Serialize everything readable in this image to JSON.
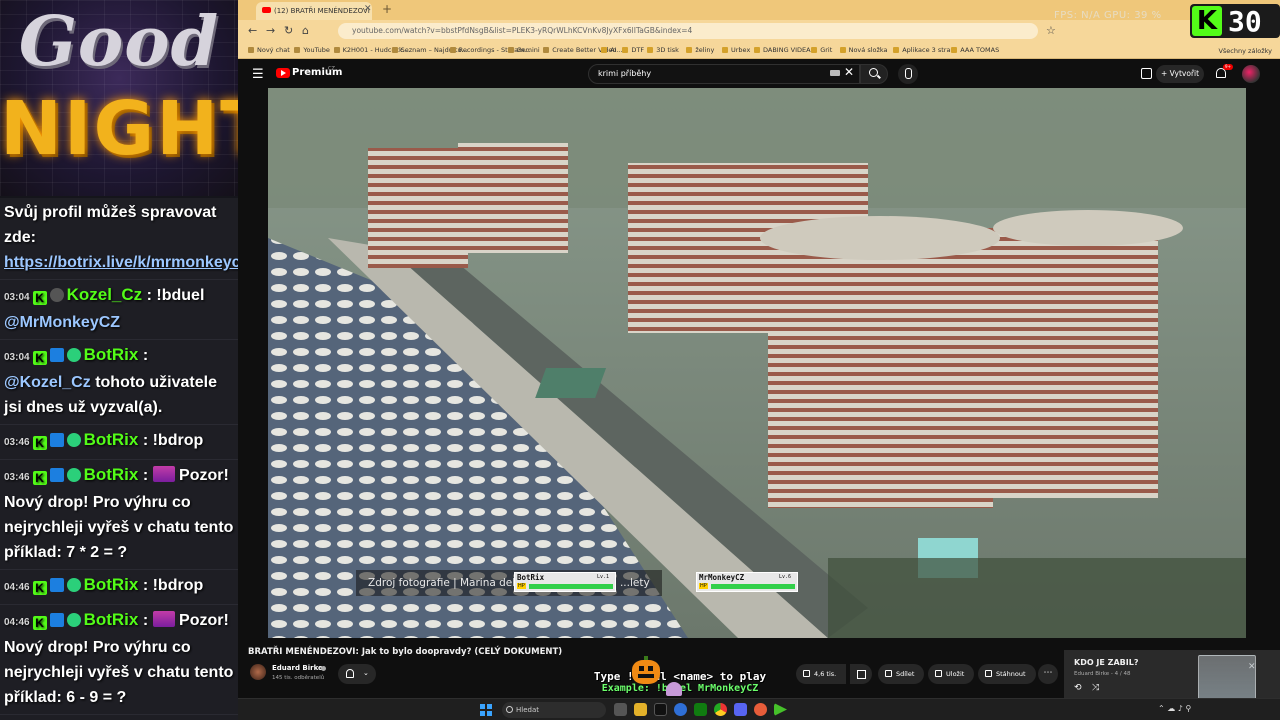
{
  "overlay": {
    "title_line1": "Good",
    "title_line2": "NIGHT",
    "counter": {
      "badge": "K",
      "value": "30"
    }
  },
  "chat": [
    {
      "id": "m1",
      "text_parts": [
        "Svůj profil můžeš spravovat zde: "
      ],
      "link": "https://botrix.live/k/mrmonkeycz/battle"
    },
    {
      "id": "m2",
      "time": "03:04",
      "user": "Kozel_Cz",
      "text": "!bduel",
      "mention": "@MrMonkeyCZ"
    },
    {
      "id": "m3",
      "time": "03:04",
      "user": "BotRix",
      "mention": "@Kozel_Cz",
      "text": "tohoto uživatele jsi dnes už vyzval(a)."
    },
    {
      "id": "m4",
      "time": "03:46",
      "user": "BotRix",
      "text": "!bdrop"
    },
    {
      "id": "m5",
      "time": "03:46",
      "user": "BotRix",
      "text": "Pozor! Nový drop! Pro výhru co nejrychleji vyřeš v chatu tento příklad: 7 * 2 = ?"
    },
    {
      "id": "m6",
      "time": "04:46",
      "user": "BotRix",
      "text": "!bdrop"
    },
    {
      "id": "m7",
      "time": "04:46",
      "user": "BotRix",
      "text": "Pozor! Nový drop! Pro výhru co nejrychleji vyřeš v chatu tento příklad: 6 - 9 = ?"
    }
  ],
  "browser": {
    "tab_title": "(12) BRATŘI MENÉNDEZOVI",
    "new_tab": "+",
    "fps_label": "FPS: N/A   GPU: 39 %",
    "url": "youtube.com/watch?v=bbstPfdNsgB&list=PLEK3-yRQrWLhKCVnKv8JyXFx6lITaGB&index=4",
    "bookmarks": [
      "Nový chat",
      "YouTube",
      "K2H001 - Hudcock...",
      "Seznam – Najdu tu...",
      "Recordings - Stream...",
      "Gemini",
      "Create Better Video...",
      "AI",
      "DTF",
      "3D tisk",
      "želiny",
      "Urbex",
      "DABING VIDEA",
      "Grit",
      "Nová složka",
      "Aplikace 3 stran",
      "AAA TOMAS"
    ],
    "bookmarks_all": "Všechny záložky"
  },
  "youtube": {
    "logo_text": "Premium",
    "logo_region": "CZ",
    "search_query": "krimi příběhy",
    "create_label": "Vytvořit",
    "notif_count": "9+",
    "caption": "Zdroj fotografie | Marina del Rey, kolem 70. let, ...lety",
    "duel": {
      "player1": {
        "name": "BotRix",
        "level": "Lv.1",
        "hp_label": "HP",
        "hp": 1.0
      },
      "player2": {
        "name": "MrMonkeyCZ",
        "level": "Lv.6",
        "hp_label": "HP",
        "hp": 1.0
      },
      "instruction": "Type !bduel <name> to play",
      "example": "Example: !bduel MrMonkeyCZ"
    },
    "video_title": "BRATŘI MENÉNDEZOVI: Jak to bylo doopravdy? (CELÝ DOKUMENT)",
    "channel_name": "Eduard Birke",
    "subscribers": "145 tis. odběratelů",
    "likes": "4,6 tis.",
    "share": "Sdílet",
    "save": "Uložit",
    "download": "Stáhnout",
    "playlist": {
      "title": "KDO JE ZABIL?",
      "subtitle": "Eduard Birke - 4 / 48"
    }
  },
  "taskbar": {
    "search_placeholder": "Hledat"
  },
  "colors": {
    "kick_green": "#53fc18",
    "tab_bar": "#efc77a",
    "youtube_red": "#ff0000",
    "gold": "#f2b21c"
  }
}
